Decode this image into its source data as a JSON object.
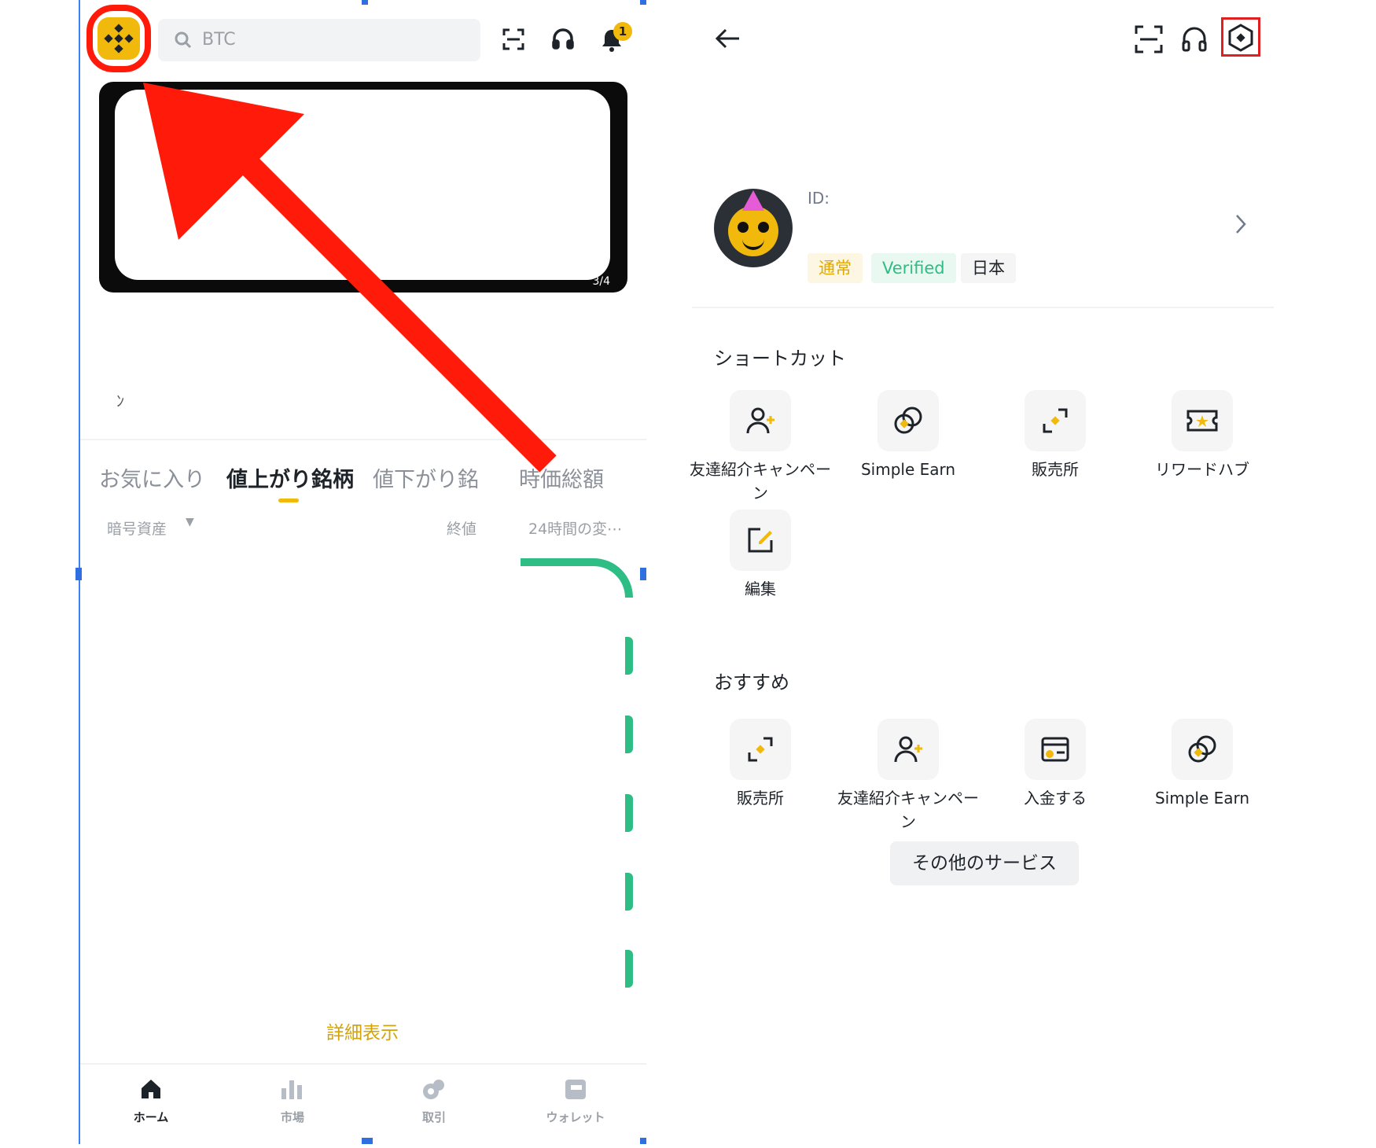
{
  "left": {
    "search_placeholder": "BTC",
    "notification_count": "1",
    "banner_pager": "3/4",
    "stray_char": "ﾝ",
    "tabs": [
      "お気に入り",
      "値上がり銘柄",
      "値下がり銘",
      "時価総額"
    ],
    "columns": {
      "asset": "暗号資産",
      "price": "終値",
      "change": "24時間の変⋯"
    },
    "more_link": "詳細表示",
    "nav": [
      "ホーム",
      "市場",
      "取引",
      "ウォレット"
    ]
  },
  "right": {
    "id_label": "ID:",
    "tags": [
      "通常",
      "Verified",
      "日本"
    ],
    "shortcuts_title": "ショートカット",
    "shortcuts": [
      {
        "label": "友達紹介キャンペーン",
        "icon": "user-plus-icon"
      },
      {
        "label": "Simple Earn",
        "icon": "coins-icon"
      },
      {
        "label": "販売所",
        "icon": "swap-icon"
      },
      {
        "label": "リワードハブ",
        "icon": "ticket-icon"
      },
      {
        "label": "編集",
        "icon": "edit-icon"
      }
    ],
    "recommended_title": "おすすめ",
    "recommended": [
      {
        "label": "販売所",
        "icon": "swap-icon"
      },
      {
        "label": "友達紹介キャンペーン",
        "icon": "user-plus-icon"
      },
      {
        "label": "入金する",
        "icon": "deposit-icon"
      },
      {
        "label": "Simple Earn",
        "icon": "coins-icon"
      }
    ],
    "more_services": "その他のサービス"
  },
  "colors": {
    "accent": "#F0B90B",
    "highlight": "#E02020",
    "green": "#2EBD85"
  }
}
